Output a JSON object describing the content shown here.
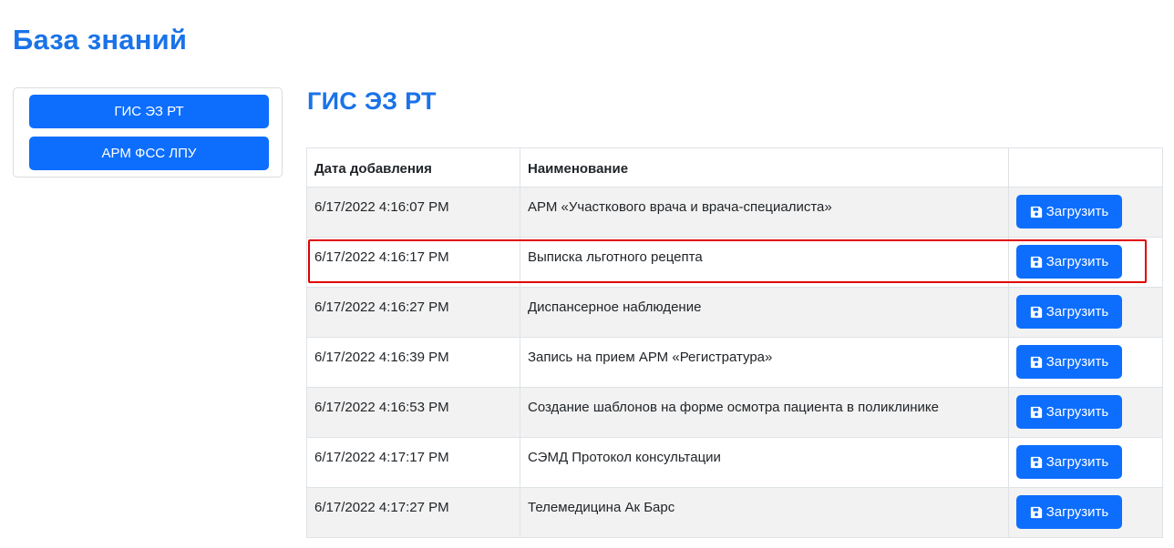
{
  "page": {
    "title": "База знаний"
  },
  "sidebar": {
    "items": [
      {
        "label": "ГИС ЭЗ РТ"
      },
      {
        "label": "АРМ ФСС ЛПУ"
      }
    ]
  },
  "section": {
    "title": "ГИС ЭЗ РТ"
  },
  "table": {
    "headers": {
      "date": "Дата добавления",
      "name": "Наименование",
      "action": ""
    },
    "button_label": "Загрузить",
    "button_icon": "save-icon",
    "rows": [
      {
        "date": "6/17/2022 4:16:07 PM",
        "name": "АРМ «Участкового врача и врача-специалиста»"
      },
      {
        "date": "6/17/2022 4:16:17 PM",
        "name": "Выписка льготного рецепта"
      },
      {
        "date": "6/17/2022 4:16:27 PM",
        "name": "Диспансерное наблюдение"
      },
      {
        "date": "6/17/2022 4:16:39 PM",
        "name": "Запись на прием АРМ «Регистратура»"
      },
      {
        "date": "6/17/2022 4:16:53 PM",
        "name": "Создание шаблонов на форме осмотра пациента в поликлинике"
      },
      {
        "date": "6/17/2022 4:17:17 PM",
        "name": "СЭМД Протокол консультации"
      },
      {
        "date": "6/17/2022 4:17:27 PM",
        "name": "Телемедицина Ак Барс"
      }
    ],
    "highlighted_row": 1
  },
  "colors": {
    "accent": "#1a73e8",
    "button": "#0d6efd",
    "highlight": "#e00000",
    "stripe": "#f2f2f2"
  }
}
